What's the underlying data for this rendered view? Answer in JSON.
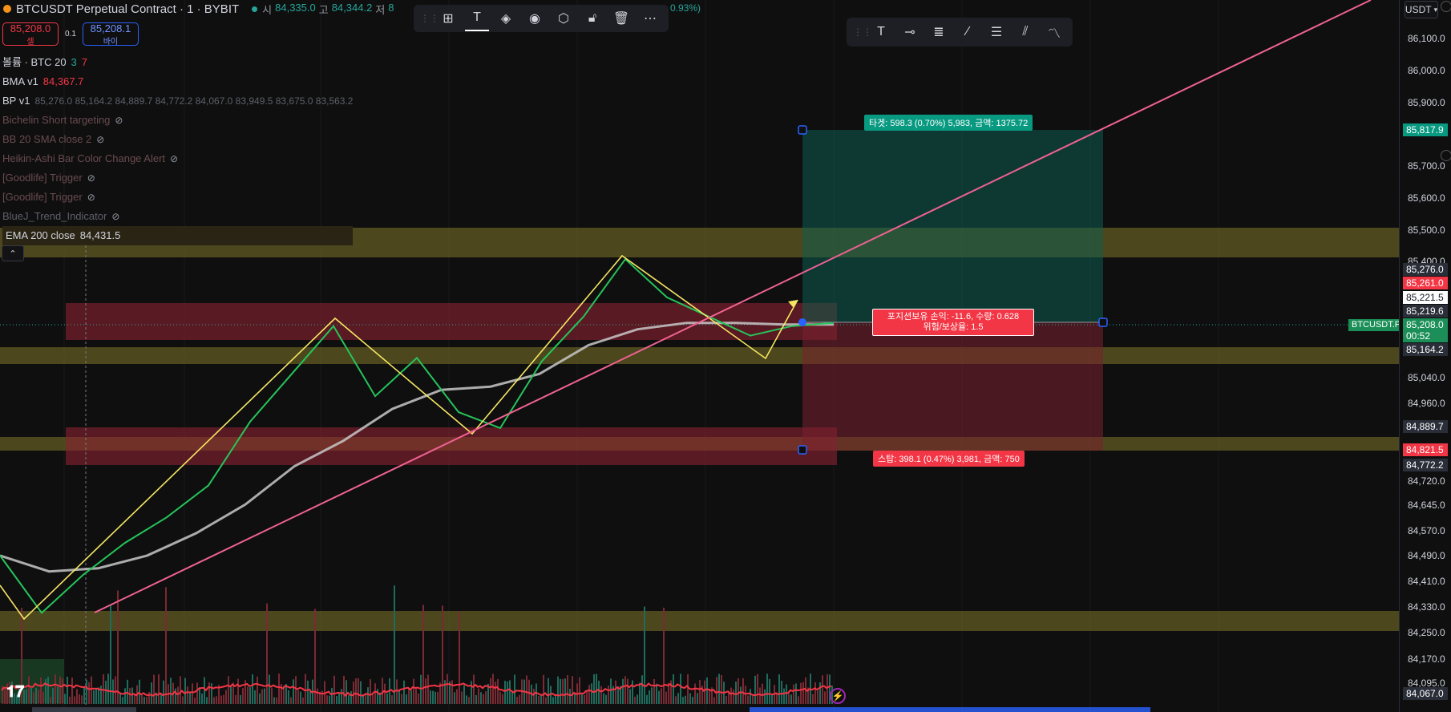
{
  "header": {
    "symbol_title": "BTCUSDT Perpetual Contract · 1 · BYBIT",
    "open_label": "시",
    "open_value": "84,335.0",
    "high_label": "고",
    "high_value": "84,344.2",
    "low_label": "저",
    "low_value": "8",
    "change_tail": "0.93%)"
  },
  "trade": {
    "sell_price": "85,208.0",
    "sell_label": "셀",
    "spread": "0.1",
    "buy_price": "85,208.1",
    "buy_label": "바이"
  },
  "legend": {
    "volume": {
      "name": "볼륨 · BTC 20",
      "v1": "3",
      "v2": "7"
    },
    "bma": {
      "name": "BMA v1",
      "value": "84,367.7"
    },
    "bp": {
      "name": "BP v1",
      "values": "85,276.0  85,164.2  84,889.7  84,772.2  84,067.0  83,949.5  83,675.0  83,563.2"
    },
    "hidden": [
      "Bichelin Short targeting",
      "BB 20 SMA close 2",
      "Heikin-Ashi Bar Color Change Alert",
      "[Goodlife] Trigger",
      "[Goodlife] Trigger",
      "BlueJ_Trend_Indicator"
    ],
    "ema": {
      "name": "EMA 200 close",
      "value": "84,431.5"
    }
  },
  "axis": {
    "currency": "USDT",
    "ticks": [
      "86,100.0",
      "86,000.0",
      "85,900.0",
      "85,700.0",
      "85,600.0",
      "85,500.0",
      "85,400.0",
      "85,040.0",
      "84,960.0",
      "84,720.0",
      "84,645.0",
      "84,570.0",
      "84,490.0",
      "84,410.0",
      "84,330.0",
      "84,250.0",
      "84,170.0",
      "84,095.0"
    ],
    "labels": {
      "target": "85,817.9",
      "bp1": "85,276.0",
      "stop_top": "85,261.0",
      "current": "85,221.5",
      "bp_mid": "85,219.6",
      "last": "85,208.0",
      "countdown": "00:52",
      "bp2": "85,164.2",
      "bp3": "84,889.7",
      "stop": "84,821.5",
      "bp4": "84,772.2",
      "bottom": "84,067.0"
    },
    "symbol_tag": "BTCUSDT.P"
  },
  "position": {
    "target_text": "타겟: 598.3 (0.70%) 5,983, 금액: 1375.72",
    "stop_text": "스탑: 398.1 (0.47%) 3,981, 금액: 750",
    "pnl_text": "포지션보유 손익: -11.6, 수량: 0.628",
    "rr_text": "위험/보상율: 1.5"
  },
  "chart_data": {
    "type": "candlestick",
    "y_axis": {
      "min": 84067.0,
      "max": 86100.0
    },
    "ticks": [
      86100.0,
      86000.0,
      85900.0,
      85700.0,
      85600.0,
      85500.0,
      85400.0,
      85040.0,
      84960.0,
      84720.0,
      84645.0,
      84570.0,
      84490.0,
      84410.0,
      84330.0,
      84250.0,
      84170.0,
      84095.0
    ],
    "price_series": [
      84480,
      84300,
      84420,
      84520,
      84600,
      84700,
      84900,
      85050,
      85200,
      84980,
      85100,
      84930,
      84880,
      85090,
      85230,
      85410,
      85290,
      85230,
      85170,
      85200,
      85210
    ],
    "ema200": [
      84480,
      84430,
      84440,
      84480,
      84550,
      84640,
      84760,
      84840,
      84940,
      85000,
      85010,
      85050,
      85140,
      85190,
      85210,
      85210,
      85205,
      85205
    ],
    "levels": {
      "target": 85817.9,
      "entry": 85208.0,
      "stop": 84821.5,
      "current": 85221.5
    }
  }
}
